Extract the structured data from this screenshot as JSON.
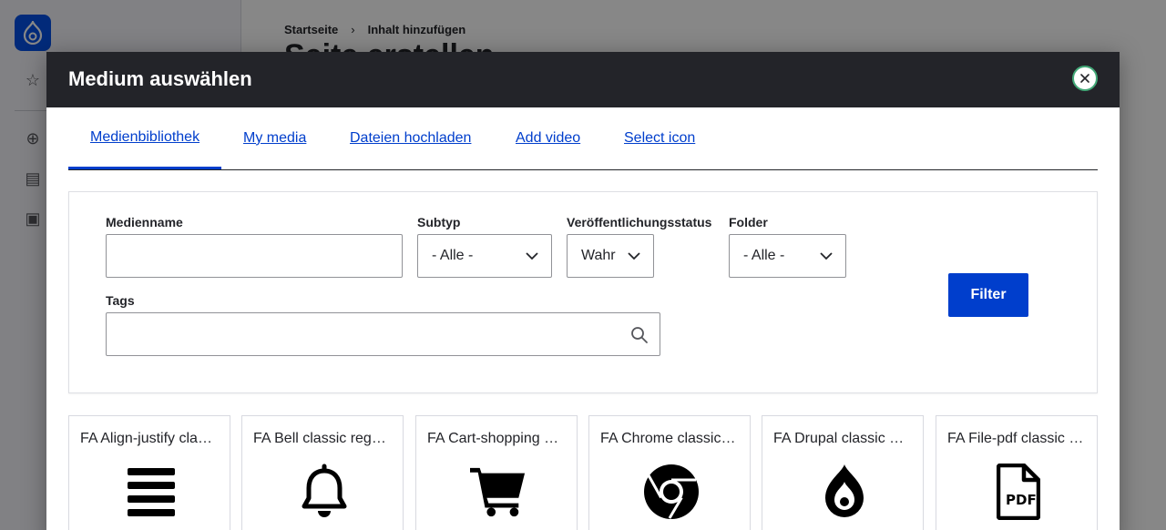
{
  "background": {
    "breadcrumb": [
      "Startseite",
      "Inhalt hinzufügen"
    ],
    "breadcrumb_separator": "›",
    "page_title": "Seite erstellen"
  },
  "dialog": {
    "title": "Medium auswählen",
    "close_label": "×"
  },
  "tabs": [
    {
      "label": "Medienbibliothek",
      "active": true
    },
    {
      "label": "My media",
      "active": false
    },
    {
      "label": "Dateien hochladen",
      "active": false
    },
    {
      "label": "Add video",
      "active": false
    },
    {
      "label": "Select icon",
      "active": false
    }
  ],
  "filters": {
    "medienname": {
      "label": "Medienname",
      "value": ""
    },
    "subtyp": {
      "label": "Subtyp",
      "value": "- Alle -"
    },
    "status": {
      "label": "Veröffentlichungsstatus",
      "value": "Wahr"
    },
    "folder": {
      "label": "Folder",
      "value": "- Alle -"
    },
    "tags": {
      "label": "Tags",
      "value": ""
    },
    "submit_label": "Filter"
  },
  "cards": [
    {
      "title": "FA Align-justify classic solid",
      "icon": "align-justify-icon"
    },
    {
      "title": "FA Bell classic regular",
      "icon": "bell-icon"
    },
    {
      "title": "FA Cart-shopping classic solid",
      "icon": "cart-shopping-icon"
    },
    {
      "title": "FA Chrome classic brands",
      "icon": "chrome-icon"
    },
    {
      "title": "FA Drupal classic brands",
      "icon": "drupal-icon"
    },
    {
      "title": "FA File-pdf classic regular",
      "icon": "file-pdf-icon"
    }
  ],
  "colors": {
    "accent": "#003ecc",
    "header_bg": "#232429",
    "close_ring": "#42a877"
  }
}
